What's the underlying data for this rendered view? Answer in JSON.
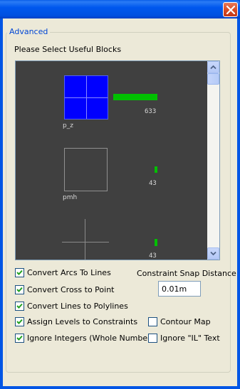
{
  "window": {
    "title": ""
  },
  "group": {
    "title": "Advanced"
  },
  "blocks": {
    "heading": "Please Select Useful Blocks",
    "items": [
      {
        "name": "p_z",
        "count": "633",
        "usage": 1.0,
        "color": "#0000ff"
      },
      {
        "name": "pmh",
        "count": "43",
        "usage": 0.068
      },
      {
        "name": "",
        "count": "43",
        "usage": 0.068
      }
    ]
  },
  "options": {
    "convert_arcs": {
      "label": "Convert Arcs To Lines",
      "checked": true
    },
    "convert_cross": {
      "label": "Convert Cross to Point",
      "checked": true
    },
    "convert_lines": {
      "label": "Convert Lines to Polylines",
      "checked": true
    },
    "assign_levels": {
      "label": "Assign Levels to Constraints",
      "checked": true
    },
    "ignore_integers": {
      "label": "Ignore Integers (Whole Numbers)",
      "checked": true
    },
    "contour_map": {
      "label": "Contour Map",
      "checked": false
    },
    "ignore_il": {
      "label": "Ignore \"IL\" Text",
      "checked": false
    }
  },
  "snap": {
    "label": "Constraint Snap Distance",
    "value": "0.01m"
  },
  "colors": {
    "titlebar": "#0055e5",
    "close_button": "#d84a22",
    "panel_background": "#404040",
    "bar": "#00c000",
    "group_title": "#0046d5",
    "dialog_background": "#ece9d8"
  }
}
